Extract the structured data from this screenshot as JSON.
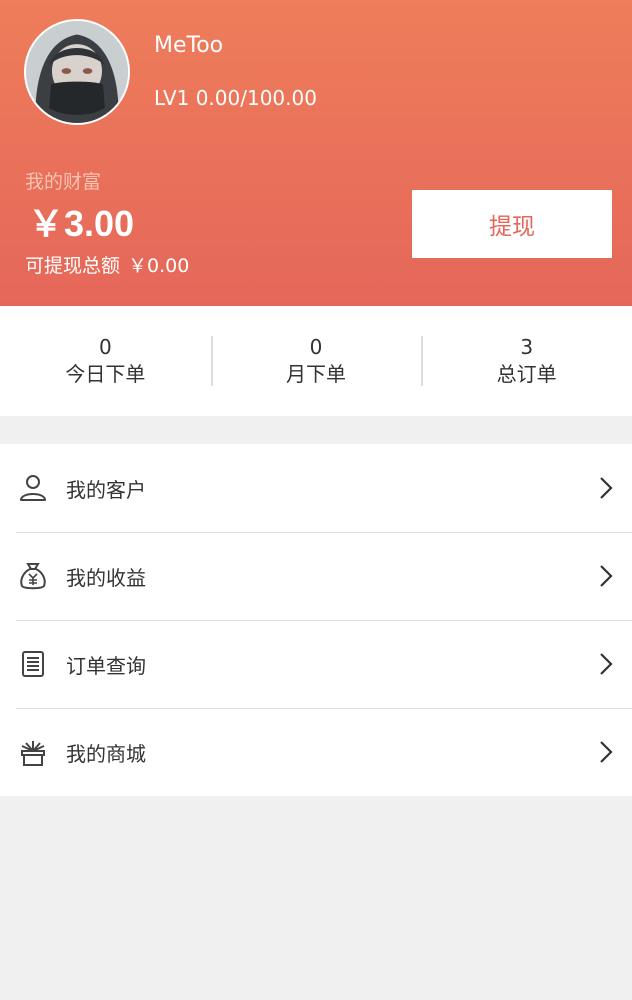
{
  "user": {
    "name": "MeToo",
    "level": "LV1 0.00/100.00"
  },
  "wealth": {
    "label": "我的财富",
    "amount": "￥3.00",
    "withdrawable_label": "可提现总额",
    "withdrawable_amount": "￥0.00",
    "withdraw_button": "提现"
  },
  "stats": [
    {
      "value": "0",
      "label": "今日下单"
    },
    {
      "value": "0",
      "label": "月下单"
    },
    {
      "value": "3",
      "label": "总订单"
    }
  ],
  "menu": [
    {
      "label": "我的客户",
      "icon": "user-icon"
    },
    {
      "label": "我的收益",
      "icon": "money-bag-icon"
    },
    {
      "label": "订单查询",
      "icon": "order-list-icon"
    },
    {
      "label": "我的商城",
      "icon": "gift-box-icon"
    }
  ],
  "colors": {
    "header_top": "#ee7d5a",
    "header_bottom": "#e5675a",
    "accent": "#e5675a",
    "background": "#f0f0f0"
  }
}
